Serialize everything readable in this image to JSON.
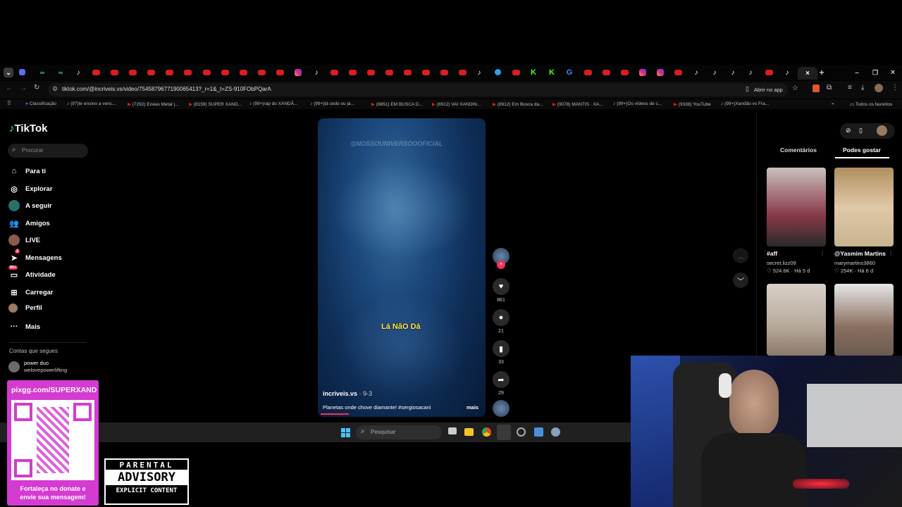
{
  "browser": {
    "url": "tiktok.com/@incriveis.vs/video/7545879677190065413?_r=1&_t=ZS-910FObPQarA",
    "open_app_label": "Abrir no app",
    "bookmarks": [
      "Classificação",
      "(97)Ie ensino a venc...",
      "(7292) Enéas Metal |...",
      "(8159) SUPER XAND...",
      "(99+)rap do XANDÃ...",
      "(99+)tá cedo ou já...",
      "(8851) EM BUSCA D...",
      "(8912) VAI XANDIN...",
      "(8912) Em Busca da...",
      "(9078) MANTIS · XA...",
      "(99+)Os vídeos de c...",
      "(9338) YouTube",
      "(99+)Xandão vs Fra..."
    ],
    "all_favorites": "Todos os favoritos"
  },
  "tiktok": {
    "logo": "TikTok",
    "search_placeholder": "Procurar",
    "nav": [
      "Para ti",
      "Explorar",
      "A seguir",
      "Amigos",
      "LIVE",
      "Mensagens",
      "Atividade",
      "Carregar",
      "Perfil",
      "Mais"
    ],
    "messages_badge": "2",
    "activity_badge": "99+",
    "following_header": "Contas que segues",
    "following": [
      {
        "name": "power duo",
        "handle": "welovepowerlifting"
      }
    ],
    "video": {
      "watermark": "@NOSSOUNIVERSOOOFICIAL",
      "caption_overlay": "Lá NãO Dá",
      "author": "incriveis.vs",
      "date": "9-3",
      "description": "Planetas onde chove diamante! #sergiosacani",
      "more": "mais",
      "likes": "861",
      "comments": "21",
      "saves": "33",
      "shares": "29"
    },
    "panel_tabs": [
      "Comentários",
      "Podes gostar"
    ],
    "suggestions": [
      {
        "title": "#aff",
        "user": "secret.lizz09",
        "views": "524.6K",
        "age": "Há 5 d",
        "color": "#8a3a4a"
      },
      {
        "title": "@Yasmim Martins",
        "user": "marymartins3860",
        "views": "254K",
        "age": "Há 6 d",
        "color": "#b08f5e"
      },
      {
        "title": "",
        "user": "",
        "views": "",
        "age": "",
        "color": "#b7a89a"
      },
      {
        "title": "",
        "user": "",
        "views": "",
        "age": "",
        "color": "#6b5a50"
      }
    ]
  },
  "taskbar": {
    "search_placeholder": "Pesquisar"
  },
  "overlay": {
    "donate_url": "pixgg.com/SUPERXAND",
    "donate_text": "Fortaleça no donate e envie sua mensagem!",
    "advisory_top": "PARENTAL",
    "advisory_mid": "ADVISORY",
    "advisory_bottom": "EXPLICIT CONTENT"
  }
}
